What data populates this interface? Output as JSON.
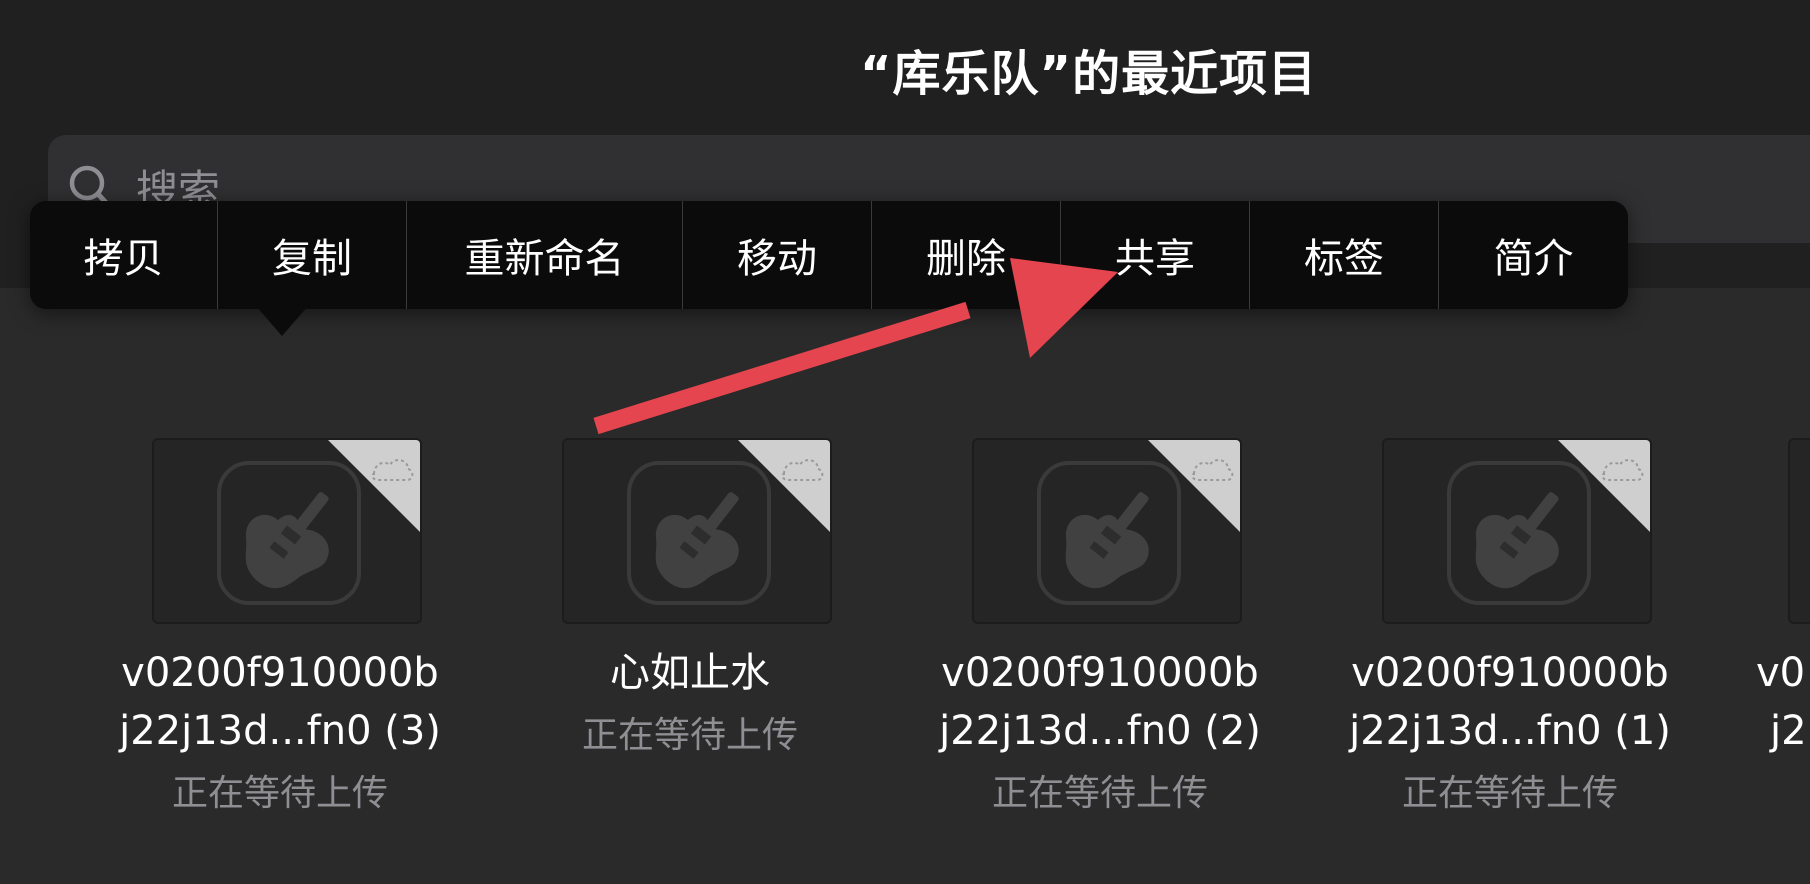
{
  "header": {
    "title": "“库乐队”的最近项目"
  },
  "search": {
    "placeholder": "搜索"
  },
  "context_menu": {
    "items": [
      {
        "label": "拷贝"
      },
      {
        "label": "复制"
      },
      {
        "label": "重新命名"
      },
      {
        "label": "移动"
      },
      {
        "label": "删除"
      },
      {
        "label": "共享"
      },
      {
        "label": "标签"
      },
      {
        "label": "简介"
      }
    ]
  },
  "documents": [
    {
      "name_line1": "v0200f910000b",
      "name_line2": "j22j13d...fn0 (3)",
      "status": "正在等待上传",
      "icon": "garageband-guitar-icon"
    },
    {
      "name_line1": "心如止水",
      "name_line2": "",
      "status": "正在等待上传",
      "icon": "garageband-guitar-icon"
    },
    {
      "name_line1": "v0200f910000b",
      "name_line2": "j22j13d...fn0 (2)",
      "status": "正在等待上传",
      "icon": "garageband-guitar-icon"
    },
    {
      "name_line1": "v0200f910000b",
      "name_line2": "j22j13d...fn0 (1)",
      "status": "正在等待上传",
      "icon": "garageband-guitar-icon"
    }
  ],
  "partial_document": {
    "name_line1": "v0",
    "name_line2": "j2"
  },
  "colors": {
    "background": "#2a2a2b",
    "menu_background": "#0b0b0b",
    "annotation_arrow": "#e5454f",
    "secondary_text": "#8e8e93"
  }
}
